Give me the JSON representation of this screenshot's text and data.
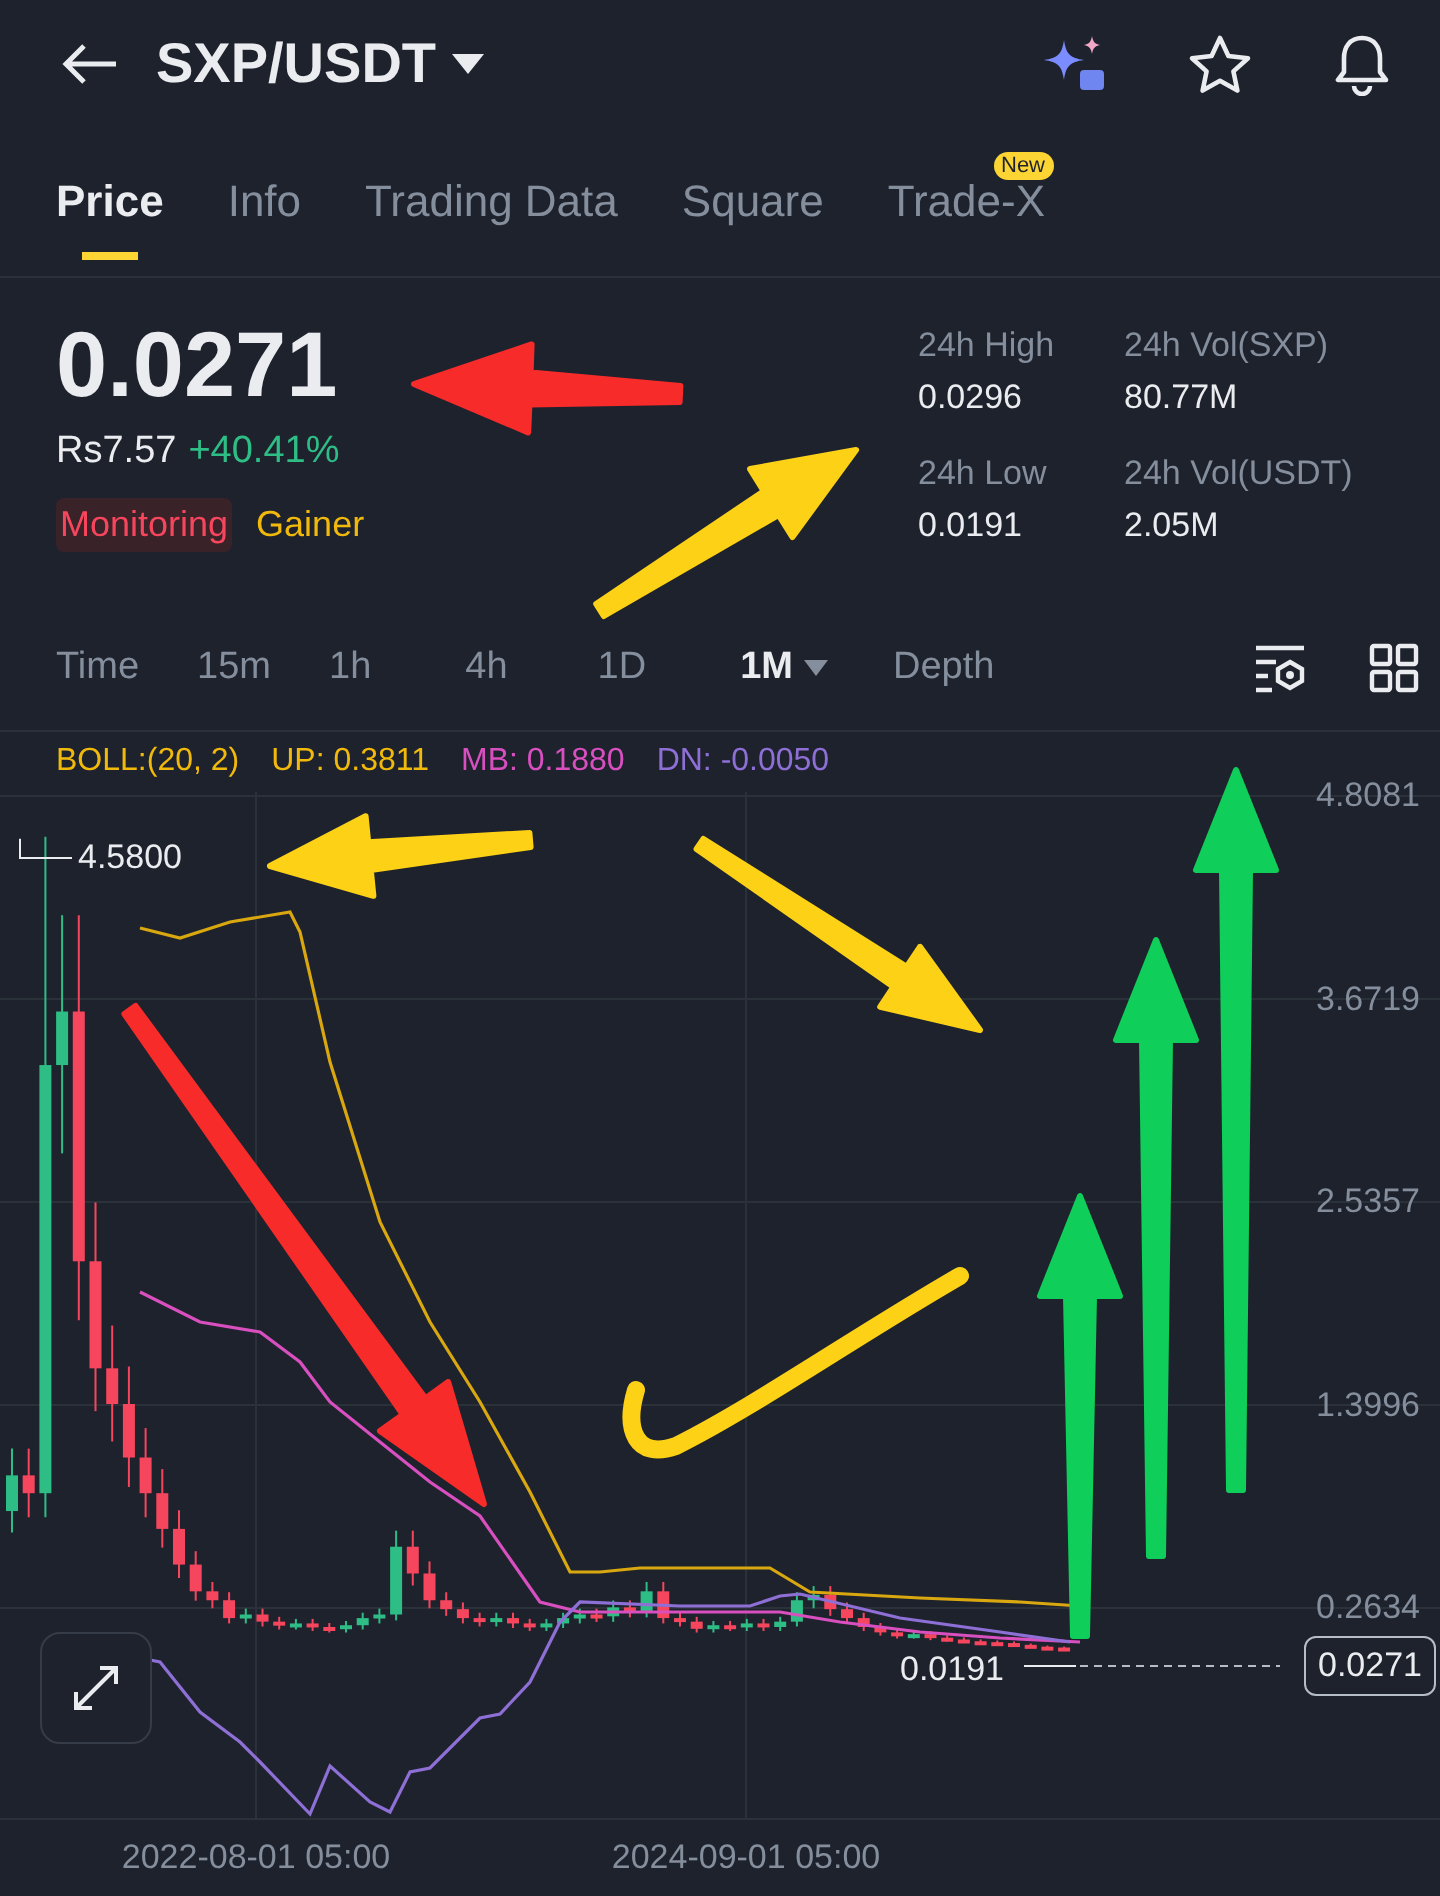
{
  "header": {
    "pair": "SXP/USDT"
  },
  "tabs": [
    {
      "label": "Price",
      "selected": true
    },
    {
      "label": "Info",
      "selected": false
    },
    {
      "label": "Trading Data",
      "selected": false
    },
    {
      "label": "Square",
      "selected": false
    },
    {
      "label": "Trade-X",
      "selected": false,
      "badge": "New"
    }
  ],
  "price": {
    "last": "0.0271",
    "fiat": "Rs7.57",
    "change": "+40.41%",
    "tags": [
      {
        "label": "Monitoring",
        "kind": "alert"
      },
      {
        "label": "Gainer",
        "kind": "gainer"
      }
    ]
  },
  "stats": [
    {
      "label": "24h High",
      "value": "0.0296"
    },
    {
      "label": "24h Vol(SXP)",
      "value": "80.77M"
    },
    {
      "label": "24h Low",
      "value": "0.0191"
    },
    {
      "label": "24h Vol(USDT)",
      "value": "2.05M"
    }
  ],
  "intervals": [
    {
      "label": "Time",
      "selected": false,
      "dropdown": false
    },
    {
      "label": "15m",
      "selected": false,
      "dropdown": false
    },
    {
      "label": "1h",
      "selected": false,
      "dropdown": false
    },
    {
      "label": "4h",
      "selected": false,
      "dropdown": false
    },
    {
      "label": "1D",
      "selected": false,
      "dropdown": false
    },
    {
      "label": "1M",
      "selected": true,
      "dropdown": true
    },
    {
      "label": "Depth",
      "selected": false,
      "dropdown": false
    }
  ],
  "indicator": {
    "name": "BOLL:(20, 2)",
    "up": "UP: 0.3811",
    "mb": "MB: 0.1880",
    "dn": "DN: -0.0050"
  },
  "chart": {
    "price_labels": [
      "4.8081",
      "3.6719",
      "2.5357",
      "1.3996",
      "0.2634"
    ],
    "max_label": "4.5800",
    "min_label": "0.0191",
    "last_price": "0.0271",
    "date_labels": [
      "2022-08-01 05:00",
      "2024-09-01 05:00"
    ]
  }
}
